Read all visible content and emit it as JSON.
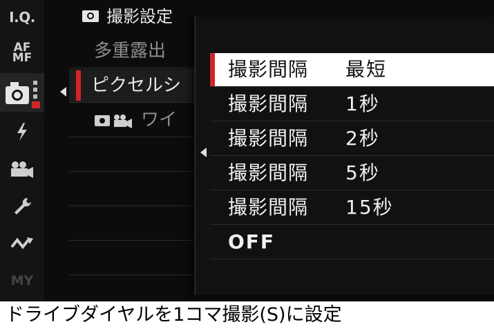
{
  "rail": {
    "iq_label": "I.Q.",
    "af_label_top": "AF",
    "af_label_bottom": "MF",
    "my_label": "MY"
  },
  "bgmenu": {
    "title": "撮影設定",
    "rows": [
      {
        "text": "多重露出"
      },
      {
        "text": "ピクセルシ"
      },
      {
        "text": "ワイ"
      }
    ]
  },
  "popup": {
    "items": [
      {
        "label": "撮影間隔",
        "value": "最短"
      },
      {
        "label": "撮影間隔",
        "value": "1秒"
      },
      {
        "label": "撮影間隔",
        "value": "2秒"
      },
      {
        "label": "撮影間隔",
        "value": "5秒"
      },
      {
        "label": "撮影間隔",
        "value": "15秒"
      },
      {
        "label": "OFF",
        "value": ""
      }
    ]
  },
  "caption": "ドライブダイヤルを1コマ撮影(S)に設定",
  "colors": {
    "accent": "#d1242a",
    "selected_bg": "#ffffff"
  }
}
